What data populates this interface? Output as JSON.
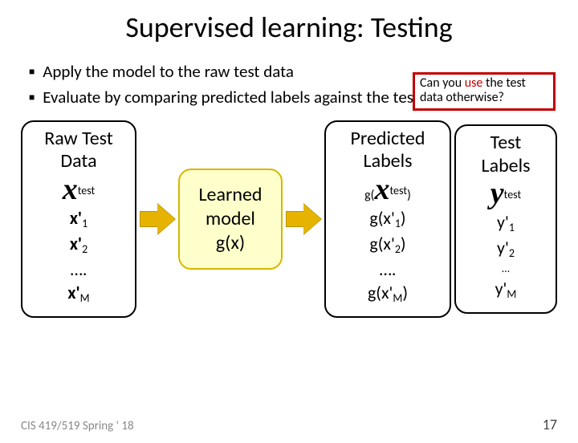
{
  "title": "Supervised learning: Testing",
  "bullets": [
    "Apply the model to the raw test data",
    "Evaluate by comparing predicted labels against the test labels"
  ],
  "callout": {
    "prefix": "Can you ",
    "highlight": "use",
    "rest": " the test data otherwise?"
  },
  "boxes": {
    "raw": {
      "heading1": "Raw Test",
      "heading2": "Data",
      "symbol": "x",
      "sup": "test",
      "items": [
        "x'",
        "x'",
        "….",
        "x'"
      ],
      "subs": [
        "1",
        "2",
        "",
        "M"
      ]
    },
    "model": {
      "l1": "Learned",
      "l2": "model",
      "l3": "g(x",
      "l3b": ")"
    },
    "predicted": {
      "heading1": "Predicted",
      "heading2": "Labels",
      "prefix": "g(",
      "symbol": "x",
      "sup": "test",
      "suffix": ")",
      "items": [
        "g(x'",
        "g(x'",
        "….",
        "g(x'"
      ],
      "subs": [
        "1",
        "2",
        "",
        "M"
      ],
      "close": [
        ")",
        ")",
        "",
        ")"
      ]
    },
    "labels": {
      "heading1": "Test",
      "heading2": "Labels",
      "symbol": "y",
      "sup": "test",
      "items": [
        "y'",
        "y'",
        "…",
        "y'"
      ],
      "subs": [
        "1",
        "2",
        "",
        "M"
      ]
    }
  },
  "footer": {
    "left": "CIS 419/519 Spring ' 18",
    "right": "17"
  }
}
